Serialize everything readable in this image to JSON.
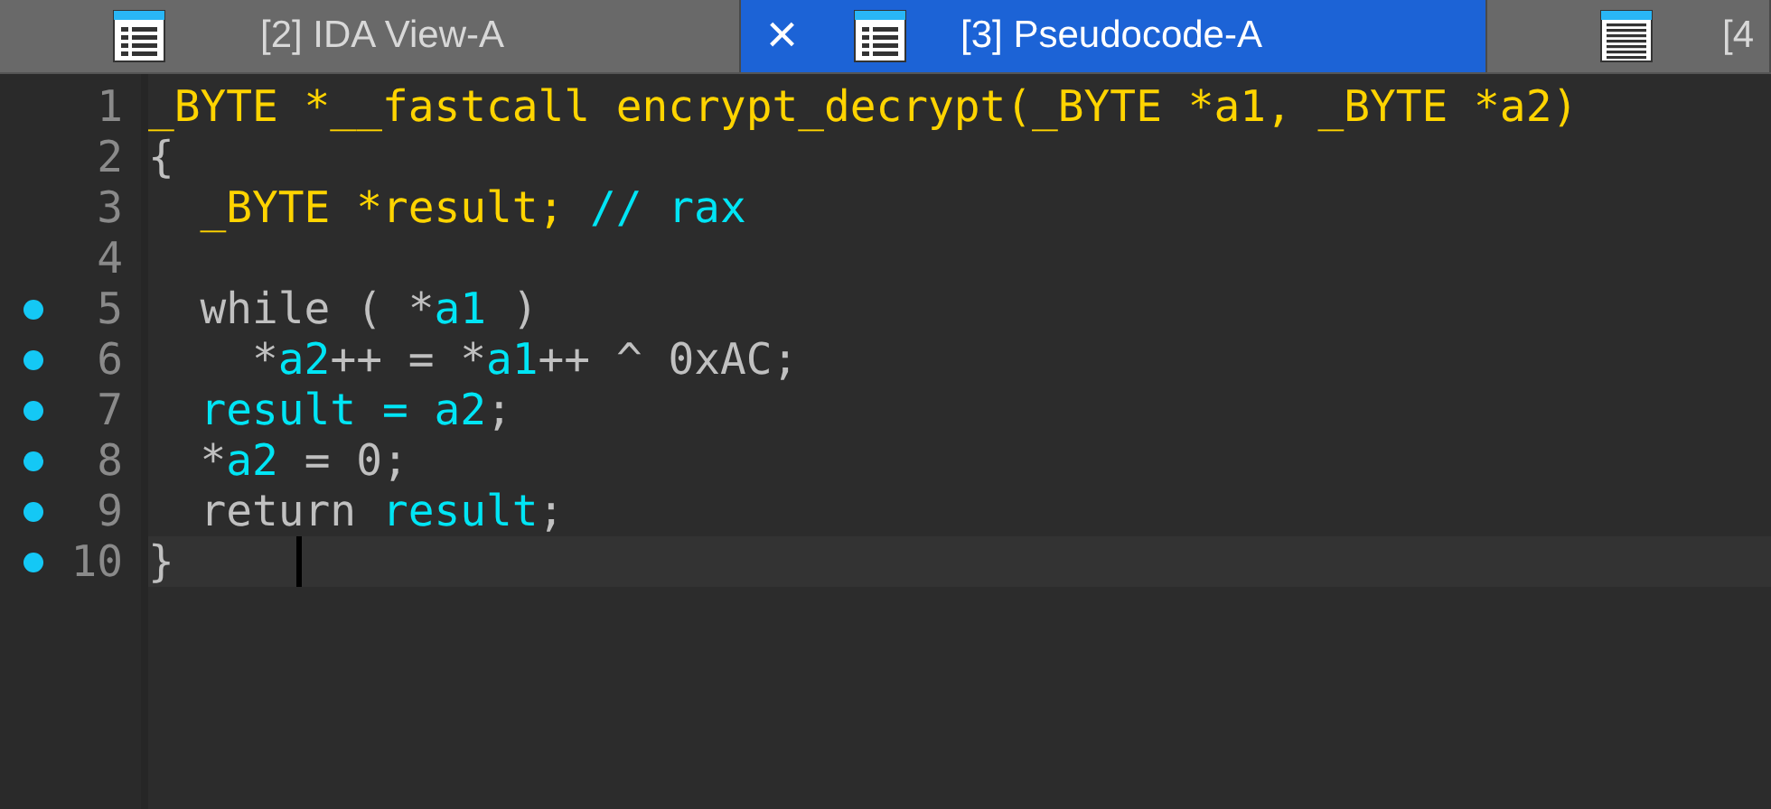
{
  "tabs": [
    {
      "label": "[2] IDA View-A",
      "selected": false
    },
    {
      "label": "[3] Pseudocode-A",
      "selected": true,
      "close": "×"
    },
    {
      "label": "[4",
      "selected": false
    }
  ],
  "code": {
    "lines": [
      {
        "number": "1",
        "dot": false,
        "current": false,
        "tokens": [
          {
            "kind": "type",
            "text": "_BYTE *__fastcall encrypt_decrypt(_BYTE *a1, _BYTE *a2)"
          }
        ]
      },
      {
        "number": "2",
        "dot": false,
        "current": false,
        "tokens": [
          {
            "kind": "plain",
            "text": "{"
          }
        ]
      },
      {
        "number": "3",
        "dot": false,
        "current": false,
        "tokens": [
          {
            "kind": "type",
            "text": "  _BYTE *result;"
          },
          {
            "kind": "var",
            "text": " // rax"
          }
        ]
      },
      {
        "number": "4",
        "dot": false,
        "current": false
      },
      {
        "number": "5",
        "dot": true,
        "current": false,
        "tokens": [
          {
            "kind": "plain",
            "text": "  while ( *"
          },
          {
            "kind": "var",
            "text": "a1"
          },
          {
            "kind": "plain",
            "text": " )"
          }
        ]
      },
      {
        "number": "6",
        "dot": true,
        "current": false,
        "tokens": [
          {
            "kind": "plain",
            "text": "    *"
          },
          {
            "kind": "var",
            "text": "a2"
          },
          {
            "kind": "plain",
            "text": "++ = *"
          },
          {
            "kind": "var",
            "text": "a1"
          },
          {
            "kind": "plain",
            "text": "++ ^ 0xAC;"
          }
        ]
      },
      {
        "number": "7",
        "dot": true,
        "current": false,
        "tokens": [
          {
            "kind": "var",
            "text": "  result = a2"
          },
          {
            "kind": "plain",
            "text": ";"
          }
        ]
      },
      {
        "number": "8",
        "dot": true,
        "current": false,
        "tokens": [
          {
            "kind": "plain",
            "text": "  *"
          },
          {
            "kind": "var",
            "text": "a2"
          },
          {
            "kind": "plain",
            "text": " = 0;"
          }
        ]
      },
      {
        "number": "9",
        "dot": true,
        "current": false,
        "tokens": [
          {
            "kind": "plain",
            "text": "  return "
          },
          {
            "kind": "var",
            "text": "result"
          },
          {
            "kind": "plain",
            "text": ";"
          }
        ]
      },
      {
        "number": "10",
        "dot": true,
        "current": true,
        "tokens": [
          {
            "kind": "plain",
            "text": "}"
          }
        ]
      }
    ]
  }
}
